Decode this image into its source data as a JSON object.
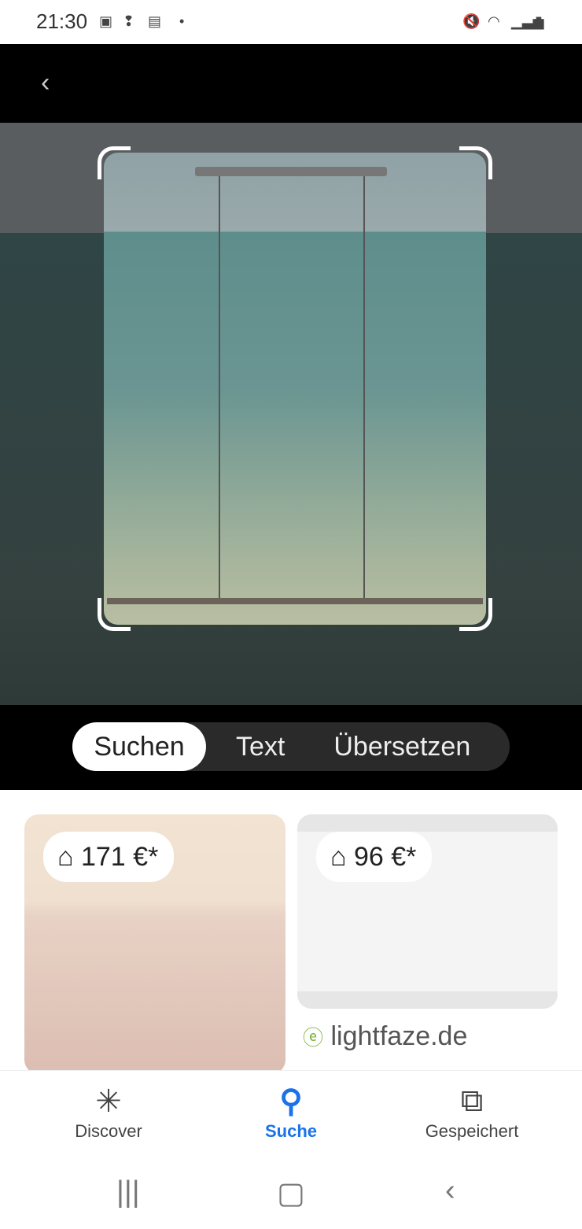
{
  "status": {
    "time": "21:30",
    "left_icons": [
      "image-icon",
      "footsteps-icon",
      "news-icon",
      "dot-icon"
    ],
    "right_icons": [
      "mute-vibrate-icon",
      "wifi-icon",
      "signal-icon",
      "battery-icon"
    ]
  },
  "modes": {
    "items": [
      "Suchen",
      "Text",
      "Übersetzen"
    ],
    "active": "Suchen"
  },
  "results": [
    {
      "price": "171 €*"
    },
    {
      "price": "96 €*",
      "source": "lightfaze.de"
    }
  ],
  "nav": {
    "items": [
      "Discover",
      "Suche",
      "Gespeichert"
    ],
    "active": "Suche",
    "active_color": "#1a73e8"
  }
}
